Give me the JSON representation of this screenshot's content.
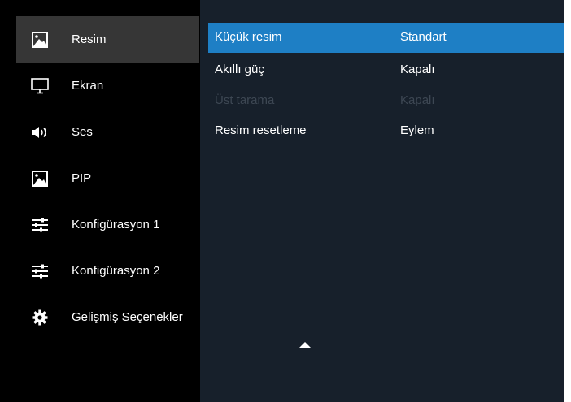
{
  "sidebar": {
    "items": [
      {
        "label": "Resim",
        "icon": "picture-icon",
        "selected": true
      },
      {
        "label": "Ekran",
        "icon": "monitor-icon",
        "selected": false
      },
      {
        "label": "Ses",
        "icon": "speaker-icon",
        "selected": false
      },
      {
        "label": "PIP",
        "icon": "picture-icon",
        "selected": false
      },
      {
        "label": "Konfigürasyon 1",
        "icon": "sliders-icon",
        "selected": false
      },
      {
        "label": "Konfigürasyon 2",
        "icon": "sliders-icon",
        "selected": false
      },
      {
        "label": "Gelişmiş Seçenekler",
        "icon": "gear-icon",
        "selected": false
      }
    ]
  },
  "panel": {
    "options": [
      {
        "label": "Küçük resim",
        "value": "Standart",
        "state": "selected"
      },
      {
        "label": "Akıllı güç",
        "value": "Kapalı",
        "state": "normal"
      },
      {
        "label": "Üst tarama",
        "value": "Kapalı",
        "state": "disabled"
      },
      {
        "label": "Resim resetleme",
        "value": "Eylem",
        "state": "normal"
      }
    ],
    "scroll_indicator": "scroll-up-arrow"
  },
  "colors": {
    "background": "#000000",
    "sidebar_selected": "#363636",
    "panel_background": "#17202b",
    "highlight": "#1e7fc5",
    "disabled_text": "#3d4753",
    "text": "#ffffff"
  }
}
